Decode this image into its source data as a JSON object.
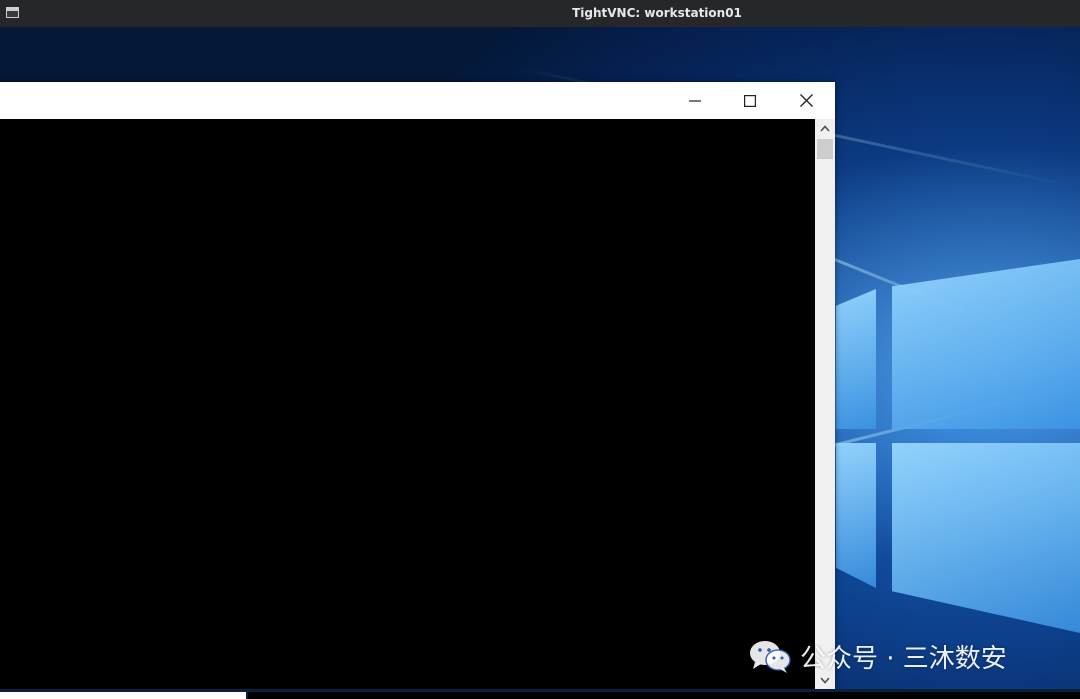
{
  "vnc_window": {
    "title": "TightVNC: workstation01"
  },
  "console_window": {
    "caption_buttons": [
      "minimize",
      "maximize",
      "close"
    ]
  },
  "watermark": {
    "text": "公众号 · 三沐数安",
    "icon": "wechat-icon"
  },
  "colors": {
    "vnc_titlebar": "#26272b",
    "console_background": "#000000",
    "desktop_blue": "#0d3f8a"
  }
}
